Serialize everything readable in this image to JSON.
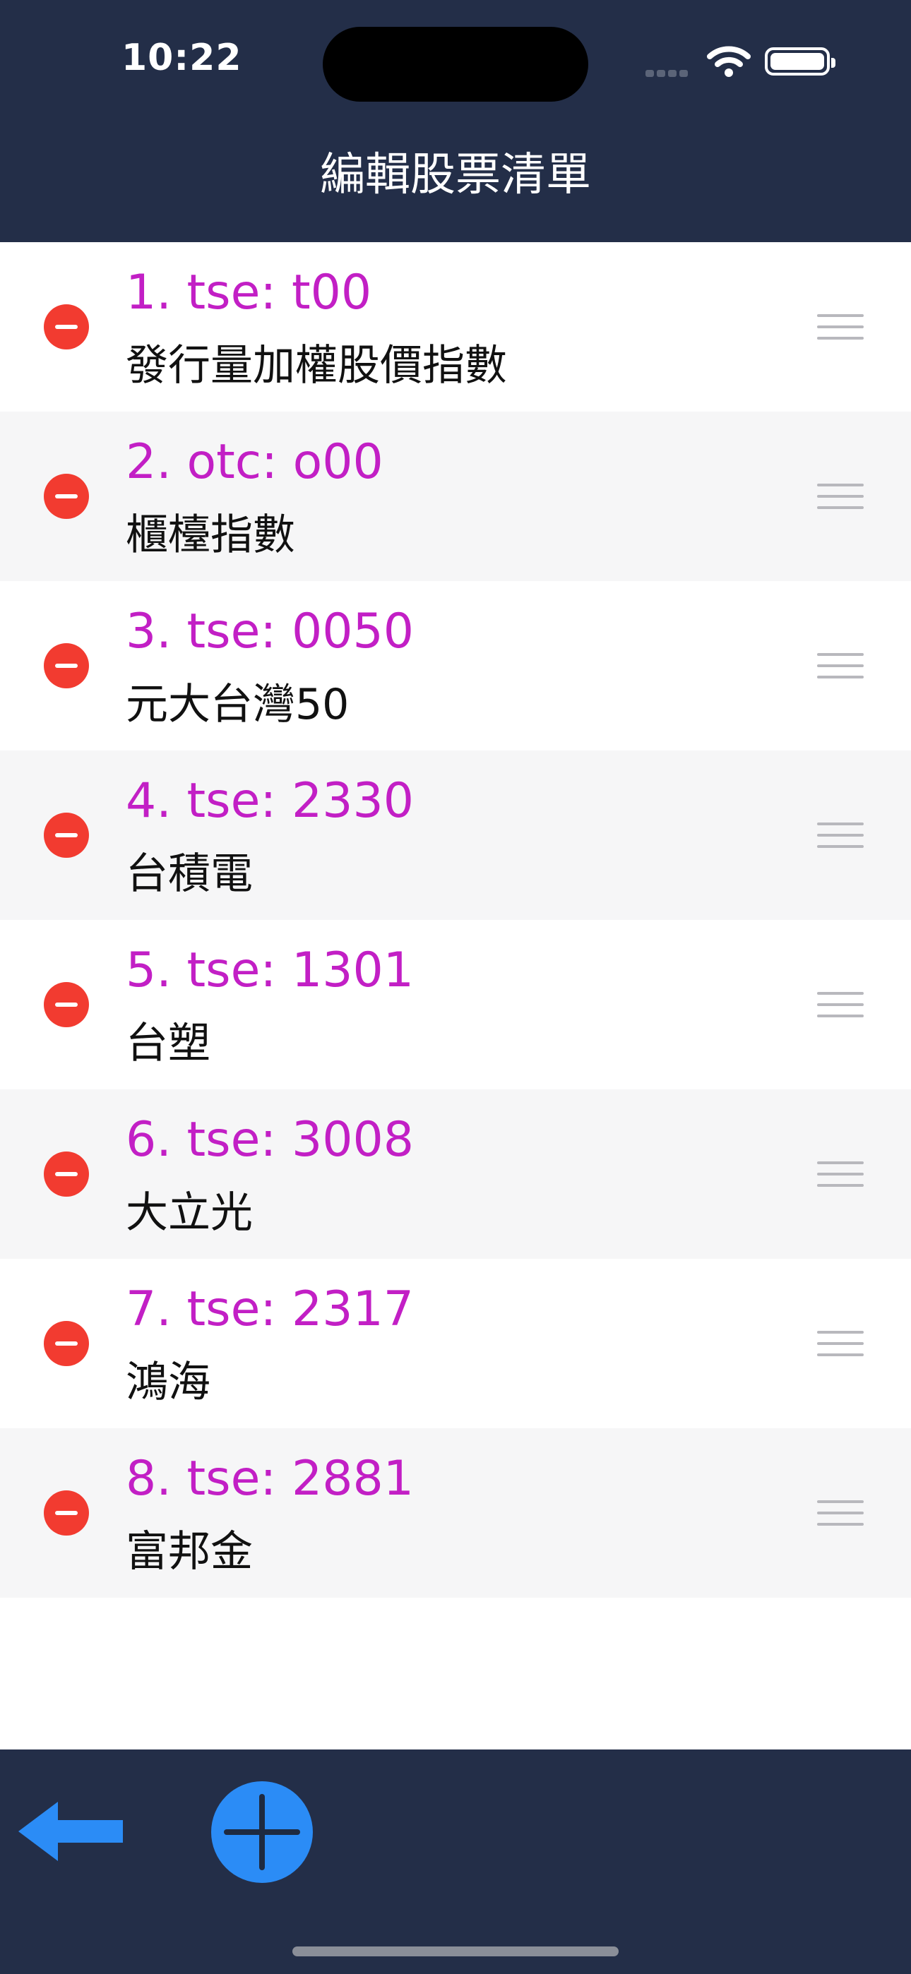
{
  "status_bar": {
    "time": "10:22"
  },
  "header": {
    "title": "編輯股票清單"
  },
  "stocks": [
    {
      "code": "1. tse: t00",
      "name": "發行量加權股價指數"
    },
    {
      "code": "2. otc: o00",
      "name": "櫃檯指數"
    },
    {
      "code": "3. tse: 0050",
      "name": "元大台灣50"
    },
    {
      "code": "4. tse: 2330",
      "name": "台積電"
    },
    {
      "code": "5. tse: 1301",
      "name": "台塑"
    },
    {
      "code": "6. tse: 3008",
      "name": "大立光"
    },
    {
      "code": "7. tse: 2317",
      "name": "鴻海"
    },
    {
      "code": "8. tse: 2881",
      "name": "富邦金"
    }
  ],
  "toolbar": {
    "back_icon": "back-arrow-icon",
    "add_icon": "plus-circle-icon"
  },
  "colors": {
    "header_bg": "#232e48",
    "code_text": "#c21fc5",
    "delete_red": "#f23b30",
    "accent_blue": "#2b8cf6"
  }
}
